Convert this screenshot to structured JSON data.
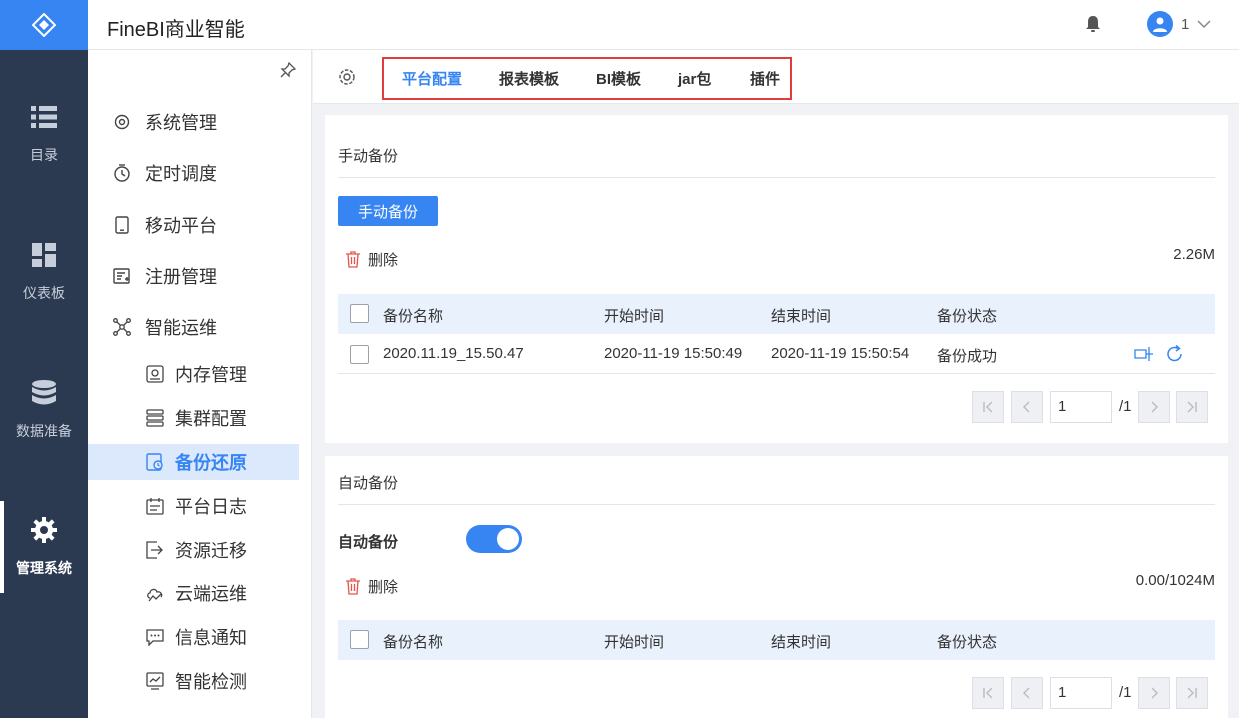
{
  "app": {
    "title": "FineBI商业智能",
    "user": "1"
  },
  "rail": {
    "items": [
      {
        "label": "目录",
        "icon": "list-icon"
      },
      {
        "label": "仪表板",
        "icon": "dashboard-icon"
      },
      {
        "label": "数据准备",
        "icon": "database-icon"
      },
      {
        "label": "管理系统",
        "icon": "gear-icon",
        "active": true
      }
    ]
  },
  "subnav": {
    "items": [
      {
        "label": "系统管理",
        "icon": "gear-outline-icon"
      },
      {
        "label": "定时调度",
        "icon": "stopwatch-icon"
      },
      {
        "label": "移动平台",
        "icon": "tablet-icon"
      },
      {
        "label": "注册管理",
        "icon": "register-icon"
      },
      {
        "label": "智能运维",
        "icon": "network-icon"
      }
    ],
    "subitems": [
      {
        "label": "内存管理",
        "icon": "memory-icon"
      },
      {
        "label": "集群配置",
        "icon": "cluster-icon"
      },
      {
        "label": "备份还原",
        "icon": "backup-icon",
        "active": true
      },
      {
        "label": "平台日志",
        "icon": "log-icon"
      },
      {
        "label": "资源迁移",
        "icon": "migrate-icon"
      },
      {
        "label": "云端运维",
        "icon": "cloud-ops-icon"
      },
      {
        "label": "信息通知",
        "icon": "message-icon"
      },
      {
        "label": "智能检测",
        "icon": "monitor-icon"
      }
    ]
  },
  "tabs": [
    {
      "label": "平台配置",
      "active": true
    },
    {
      "label": "报表模板"
    },
    {
      "label": "BI模板"
    },
    {
      "label": "jar包"
    },
    {
      "label": "插件"
    }
  ],
  "manual": {
    "title": "手动备份",
    "button": "手动备份",
    "delete": "删除",
    "size": "2.26M",
    "columns": [
      "备份名称",
      "开始时间",
      "结束时间",
      "备份状态"
    ],
    "rows": [
      {
        "name": "2020.11.19_15.50.47",
        "start": "2020-11-19 15:50:49",
        "end": "2020-11-19 15:50:54",
        "status": "备份成功"
      }
    ],
    "page": "1",
    "total": "/1"
  },
  "auto": {
    "title": "自动备份",
    "switch_label": "自动备份",
    "switch_on": true,
    "delete": "删除",
    "size": "0.00/1024M",
    "columns": [
      "备份名称",
      "开始时间",
      "结束时间",
      "备份状态"
    ],
    "page": "1",
    "total": "/1"
  },
  "colors": {
    "accent": "#3685f2",
    "rail": "#2b3a51",
    "highlight_box": "#e03c3c"
  }
}
